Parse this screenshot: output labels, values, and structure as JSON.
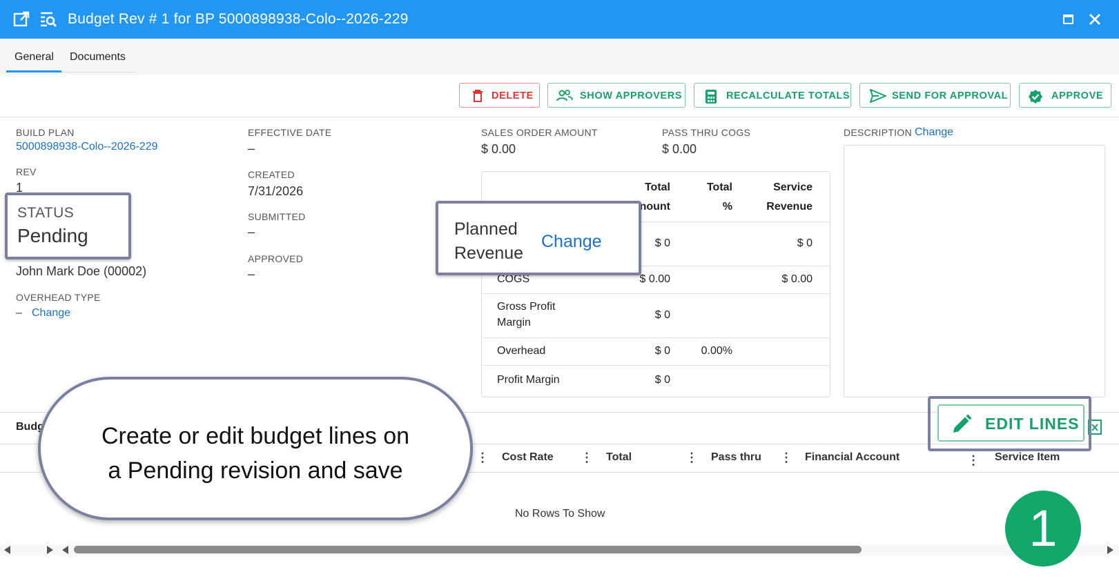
{
  "window": {
    "title": "Budget Rev # 1 for BP 5000898938-Colo--2026-229",
    "icons": [
      "open-external-icon",
      "find-in-page-icon",
      "maximize-icon",
      "close-icon"
    ]
  },
  "tabs": [
    {
      "label": "General",
      "active": true
    },
    {
      "label": "Documents",
      "active": false
    }
  ],
  "toolbar": {
    "delete": "DELETE",
    "show_approvers": "SHOW APPROVERS",
    "recalculate": "RECALCULATE TOTALS",
    "send_for_approval": "SEND FOR APPROVAL",
    "approve": "APPROVE"
  },
  "details": {
    "build_plan_label": "BUILD PLAN",
    "build_plan_value": "5000898938-Colo--2026-229",
    "rev_label": "REV",
    "rev_value": "1",
    "status_label": "STATUS",
    "status_value": "Pending",
    "owner": "John Mark Doe (00002)",
    "overhead_type_label": "OVERHEAD TYPE",
    "overhead_type_value": "–",
    "overhead_type_change": "Change",
    "effective_date_label": "EFFECTIVE DATE",
    "effective_date_value": "–",
    "created_label": "CREATED",
    "created_value": "7/31/2026",
    "submitted_label": "SUBMITTED",
    "submitted_value": "–",
    "approved_label": "APPROVED",
    "approved_value": "–",
    "sales_order_label": "SALES ORDER AMOUNT",
    "sales_order_value": "$ 0.00",
    "pass_thru_label": "PASS THRU COGS",
    "pass_thru_value": "$ 0.00",
    "description_label": "DESCRIPTION",
    "description_change": "Change"
  },
  "summary": {
    "headers": {
      "total_amount_1": "Total",
      "total_amount_2": "nount",
      "total_pct_1": "Total",
      "total_pct_2": "%",
      "service_rev_1": "Service",
      "service_rev_2": "Revenue"
    },
    "rows": [
      {
        "label": "",
        "amount": "$ 0",
        "pct": "",
        "service": "$ 0"
      },
      {
        "label": "COGS",
        "amount": "$ 0.00",
        "pct": "",
        "service": "$ 0.00"
      },
      {
        "label_1": "Gross Profit",
        "label_2": "Margin",
        "amount": "$ 0",
        "pct": "",
        "service": ""
      },
      {
        "label": "Overhead",
        "amount": "$ 0",
        "pct": "0.00%",
        "service": ""
      },
      {
        "label": "Profit Margin",
        "amount": "$ 0",
        "pct": "",
        "service": ""
      }
    ]
  },
  "planned_revenue_popup": {
    "label_1": "Planned",
    "label_2": "Revenue",
    "change": "Change"
  },
  "grid": {
    "section_title": "Budg",
    "columns": [
      "Cost Rate",
      "Total",
      "Pass thru",
      "Financial Account",
      "Service Item"
    ],
    "empty_text": "No Rows To Show",
    "edit_lines": "EDIT LINES"
  },
  "callout": {
    "line_1": "Create or edit budget lines on",
    "line_2": "a Pending revision and save"
  },
  "step_number": "1",
  "colors": {
    "titlebar": "#2196f3",
    "accent_green": "#16a06a",
    "danger_red": "#e03434",
    "link_blue": "#1a73c8",
    "callout_border": "#7b7fa0",
    "step_badge": "#12a86a"
  }
}
